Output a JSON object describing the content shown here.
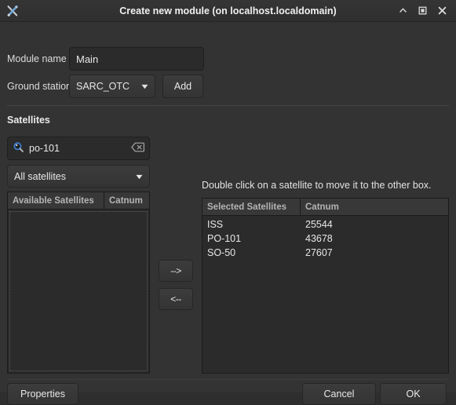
{
  "window": {
    "title": "Create new module (on localhost.localdomain)",
    "app_icon": "tools-icon",
    "controls": {
      "shade_label": "∧",
      "maximize_label": "□",
      "close_label": "✕"
    }
  },
  "form": {
    "module_name_label": "Module name",
    "module_name_value": "Main",
    "module_name_placeholder": "",
    "ground_station_label": "Ground station",
    "ground_station_value": "SARC_OTC",
    "add_label": "Add",
    "caret": "▼"
  },
  "satellites": {
    "section_title": "Satellites",
    "search_value": "po-101",
    "search_placeholder": "",
    "search_icon": "magnifier-icon",
    "clear_icon": "clear-backspace-icon",
    "filter_value": "All satellites",
    "available": {
      "columns": [
        "Available Satellites",
        "Catnum"
      ],
      "rows": []
    },
    "transfer": {
      "to_right_label": "-->",
      "to_left_label": "<--"
    },
    "hint": "Double click on a satellite to move it to the other box.",
    "selected": {
      "columns": [
        "Selected Satellites",
        "Catnum"
      ],
      "rows": [
        {
          "name": "ISS",
          "catnum": "25544"
        },
        {
          "name": "PO-101",
          "catnum": "43678"
        },
        {
          "name": "SO-50",
          "catnum": "27607"
        }
      ]
    }
  },
  "footer": {
    "properties_label": "Properties",
    "cancel_label": "Cancel",
    "ok_label": "OK"
  },
  "colors": {
    "window_bg": "#333333",
    "titlebar_bg": "#2f2f2f",
    "field_bg": "#2b2b2b",
    "button_bg": "#3a3a3a",
    "text": "#e8e8e8",
    "header_text": "#b4b4b4",
    "accent_blue": "#3d7fd6"
  }
}
